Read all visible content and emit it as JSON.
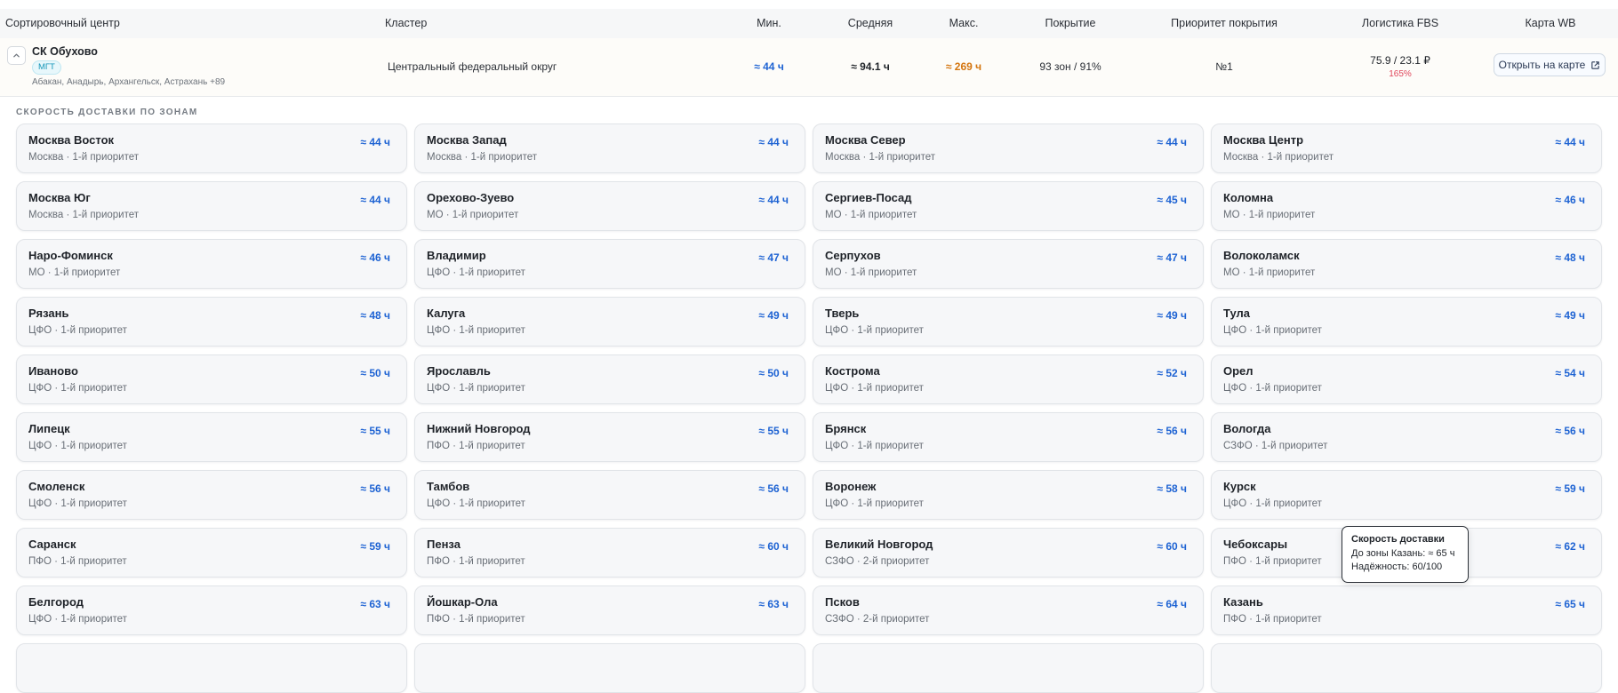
{
  "header": {
    "sort_center": "Сортировочный центр",
    "cluster": "Кластер",
    "min": "Мин.",
    "avg": "Средняя",
    "max": "Макс.",
    "coverage": "Покрытие",
    "coverage_priority": "Приоритет покрытия",
    "logistics": "Логистика FBS",
    "map": "Карта WB"
  },
  "row": {
    "name": "СК Обухово",
    "badge": "МГТ",
    "cities": "Абакан, Анадырь, Архангельск, Астрахань +89",
    "cluster": "Центральный федеральный округ",
    "min": "≈ 44 ч",
    "avg": "≈ 94.1 ч",
    "max": "≈ 269 ч",
    "coverage": "93 зон / 91%",
    "priority": "№1",
    "fbs": "75.9 / 23.1 ₽",
    "fbs_pct": "165%",
    "map_button": "Открыть на карте"
  },
  "section_title": "СКОРОСТЬ ДОСТАВКИ ПО ЗОНАМ",
  "zones": [
    {
      "name": "Москва Восток",
      "sub": "Москва · 1-й приоритет",
      "time": "≈ 44 ч"
    },
    {
      "name": "Москва Запад",
      "sub": "Москва · 1-й приоритет",
      "time": "≈ 44 ч"
    },
    {
      "name": "Москва Север",
      "sub": "Москва · 1-й приоритет",
      "time": "≈ 44 ч"
    },
    {
      "name": "Москва Центр",
      "sub": "Москва · 1-й приоритет",
      "time": "≈ 44 ч"
    },
    {
      "name": "Москва Юг",
      "sub": "Москва · 1-й приоритет",
      "time": "≈ 44 ч"
    },
    {
      "name": "Орехово-Зуево",
      "sub": "МО · 1-й приоритет",
      "time": "≈ 44 ч"
    },
    {
      "name": "Сергиев-Посад",
      "sub": "МО · 1-й приоритет",
      "time": "≈ 45 ч"
    },
    {
      "name": "Коломна",
      "sub": "МО · 1-й приоритет",
      "time": "≈ 46 ч"
    },
    {
      "name": "Наро-Фоминск",
      "sub": "МО · 1-й приоритет",
      "time": "≈ 46 ч"
    },
    {
      "name": "Владимир",
      "sub": "ЦФО · 1-й приоритет",
      "time": "≈ 47 ч"
    },
    {
      "name": "Серпухов",
      "sub": "МО · 1-й приоритет",
      "time": "≈ 47 ч"
    },
    {
      "name": "Волоколамск",
      "sub": "МО · 1-й приоритет",
      "time": "≈ 48 ч"
    },
    {
      "name": "Рязань",
      "sub": "ЦФО · 1-й приоритет",
      "time": "≈ 48 ч"
    },
    {
      "name": "Калуга",
      "sub": "ЦФО · 1-й приоритет",
      "time": "≈ 49 ч"
    },
    {
      "name": "Тверь",
      "sub": "ЦФО · 1-й приоритет",
      "time": "≈ 49 ч"
    },
    {
      "name": "Тула",
      "sub": "ЦФО · 1-й приоритет",
      "time": "≈ 49 ч"
    },
    {
      "name": "Иваново",
      "sub": "ЦФО · 1-й приоритет",
      "time": "≈ 50 ч"
    },
    {
      "name": "Ярославль",
      "sub": "ЦФО · 1-й приоритет",
      "time": "≈ 50 ч"
    },
    {
      "name": "Кострома",
      "sub": "ЦФО · 1-й приоритет",
      "time": "≈ 52 ч"
    },
    {
      "name": "Орел",
      "sub": "ЦФО · 1-й приоритет",
      "time": "≈ 54 ч"
    },
    {
      "name": "Липецк",
      "sub": "ЦФО · 1-й приоритет",
      "time": "≈ 55 ч"
    },
    {
      "name": "Нижний Новгород",
      "sub": "ПФО · 1-й приоритет",
      "time": "≈ 55 ч"
    },
    {
      "name": "Брянск",
      "sub": "ЦФО · 1-й приоритет",
      "time": "≈ 56 ч"
    },
    {
      "name": "Вологда",
      "sub": "СЗФО · 1-й приоритет",
      "time": "≈ 56 ч"
    },
    {
      "name": "Смоленск",
      "sub": "ЦФО · 1-й приоритет",
      "time": "≈ 56 ч"
    },
    {
      "name": "Тамбов",
      "sub": "ЦФО · 1-й приоритет",
      "time": "≈ 56 ч"
    },
    {
      "name": "Воронеж",
      "sub": "ЦФО · 1-й приоритет",
      "time": "≈ 58 ч"
    },
    {
      "name": "Курск",
      "sub": "ЦФО · 1-й приоритет",
      "time": "≈ 59 ч"
    },
    {
      "name": "Саранск",
      "sub": "ПФО · 1-й приоритет",
      "time": "≈ 59 ч"
    },
    {
      "name": "Пенза",
      "sub": "ПФО · 1-й приоритет",
      "time": "≈ 60 ч"
    },
    {
      "name": "Великий Новгород",
      "sub": "СЗФО · 2-й приоритет",
      "time": "≈ 60 ч"
    },
    {
      "name": "Чебоксары",
      "sub": "ПФО · 1-й приоритет",
      "time": "≈ 62 ч"
    },
    {
      "name": "Белгород",
      "sub": "ЦФО · 1-й приоритет",
      "time": "≈ 63 ч"
    },
    {
      "name": "Йошкар-Ола",
      "sub": "ПФО · 1-й приоритет",
      "time": "≈ 63 ч"
    },
    {
      "name": "Псков",
      "sub": "СЗФО · 2-й приоритет",
      "time": "≈ 64 ч"
    },
    {
      "name": "Казань",
      "sub": "ПФО · 1-й приоритет",
      "time": "≈ 65 ч"
    },
    {
      "name": "",
      "sub": "",
      "time": ""
    },
    {
      "name": "",
      "sub": "",
      "time": ""
    },
    {
      "name": "",
      "sub": "",
      "time": ""
    },
    {
      "name": "",
      "sub": "",
      "time": ""
    }
  ],
  "tooltip": {
    "title": "Скорость доставки",
    "line1": "До зоны Казань: ≈ 65 ч",
    "line2": "Надёжность: 60/100"
  },
  "colors": {
    "accent_blue": "#1e63d3",
    "max_orange": "#d4750f",
    "pct_red": "#e0455a",
    "badge_cyan": "#1596b8"
  },
  "icons": {
    "toggle": "chevron-up-icon",
    "map_button": "external-link-icon"
  }
}
